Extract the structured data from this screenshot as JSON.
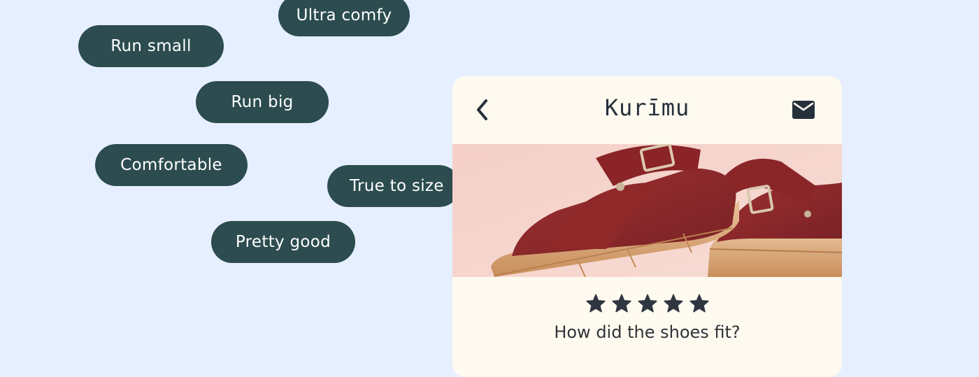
{
  "chips": {
    "ultra_comfy": "Ultra comfy",
    "run_small": "Run small",
    "run_big": "Run big",
    "comfortable": "Comfortable",
    "true_to_size": "True to size",
    "pretty_good": "Pretty good"
  },
  "card": {
    "brand": "Kurīmu",
    "back_icon": "chevron-left-icon",
    "mail_icon": "mail-icon",
    "image": "red leather platform sandals on wooden soles",
    "rating": {
      "value": 5,
      "max": 5
    },
    "question": "How did the shoes fit?"
  },
  "colors": {
    "background": "#e6efff",
    "chip": "#2c4c4f",
    "card": "#fffaf0",
    "text_dark": "#25303a",
    "sandal_leather": "#8e2a2c"
  }
}
